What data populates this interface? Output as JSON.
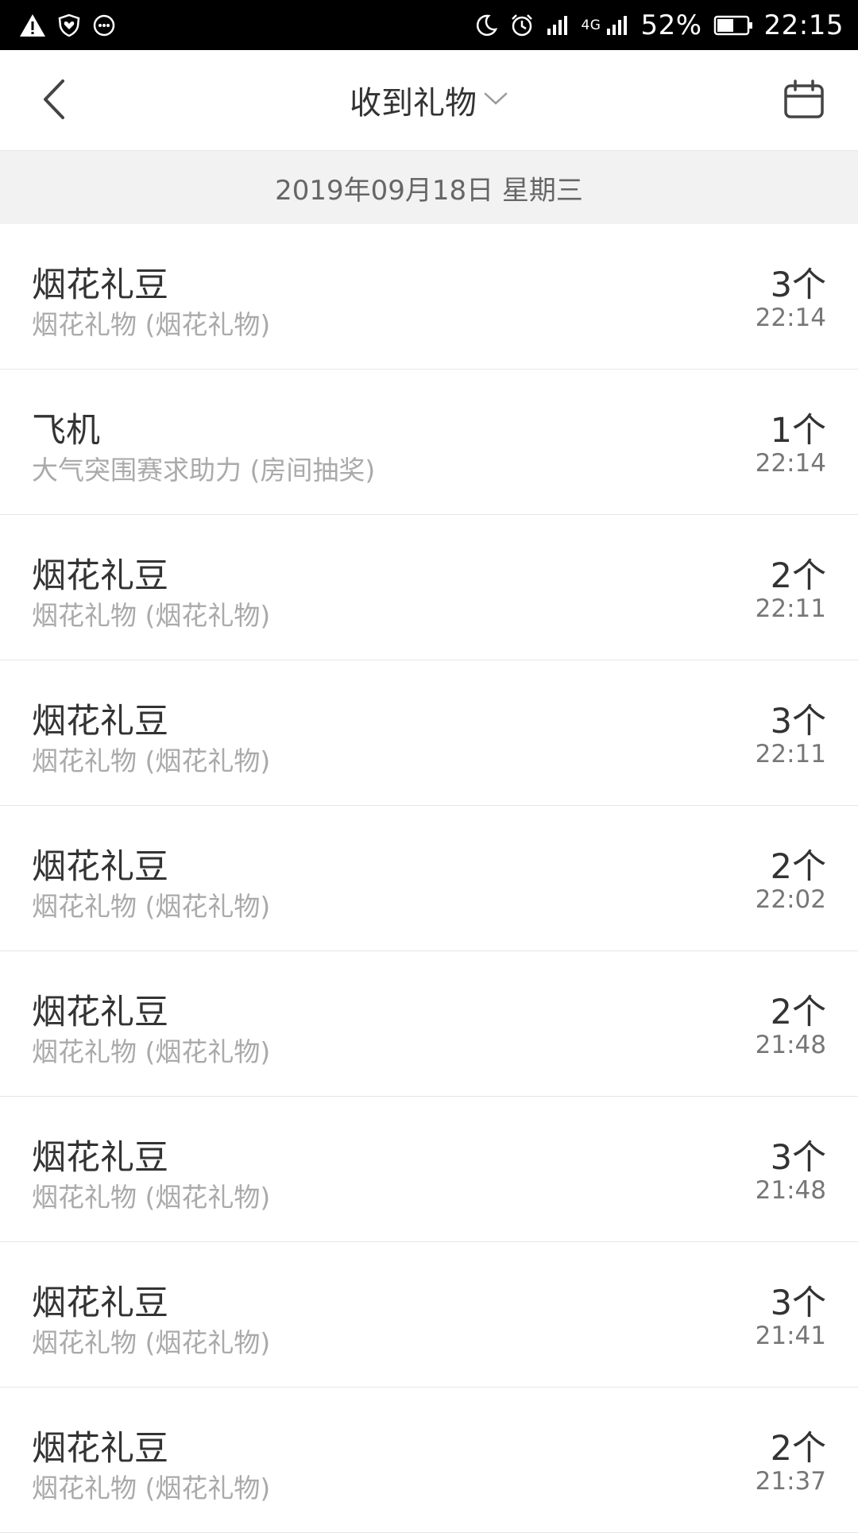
{
  "status_bar": {
    "battery_percent": "52%",
    "time": "22:15",
    "network_type": "4G",
    "icons": [
      "warning-icon",
      "shield-heart-icon",
      "message-icon",
      "moon-icon",
      "alarm-icon",
      "signal-icon",
      "signal-4g-icon",
      "battery-icon"
    ]
  },
  "header": {
    "title": "收到礼物",
    "back_icon": "chevron-left-icon",
    "dropdown_icon": "chevron-down-icon",
    "calendar_icon": "calendar-icon"
  },
  "date_header": "2019年09月18日 星期三",
  "gifts": [
    {
      "name": "烟花礼豆",
      "source": "烟花礼物 (烟花礼物)",
      "quantity": "3个",
      "time": "22:14"
    },
    {
      "name": "飞机",
      "source": "大气突围赛求助力 (房间抽奖)",
      "quantity": "1个",
      "time": "22:14"
    },
    {
      "name": "烟花礼豆",
      "source": "烟花礼物 (烟花礼物)",
      "quantity": "2个",
      "time": "22:11"
    },
    {
      "name": "烟花礼豆",
      "source": "烟花礼物 (烟花礼物)",
      "quantity": "3个",
      "time": "22:11"
    },
    {
      "name": "烟花礼豆",
      "source": "烟花礼物 (烟花礼物)",
      "quantity": "2个",
      "time": "22:02"
    },
    {
      "name": "烟花礼豆",
      "source": "烟花礼物 (烟花礼物)",
      "quantity": "2个",
      "time": "21:48"
    },
    {
      "name": "烟花礼豆",
      "source": "烟花礼物 (烟花礼物)",
      "quantity": "3个",
      "time": "21:48"
    },
    {
      "name": "烟花礼豆",
      "source": "烟花礼物 (烟花礼物)",
      "quantity": "3个",
      "time": "21:41"
    },
    {
      "name": "烟花礼豆",
      "source": "烟花礼物 (烟花礼物)",
      "quantity": "2个",
      "time": "21:37"
    }
  ]
}
